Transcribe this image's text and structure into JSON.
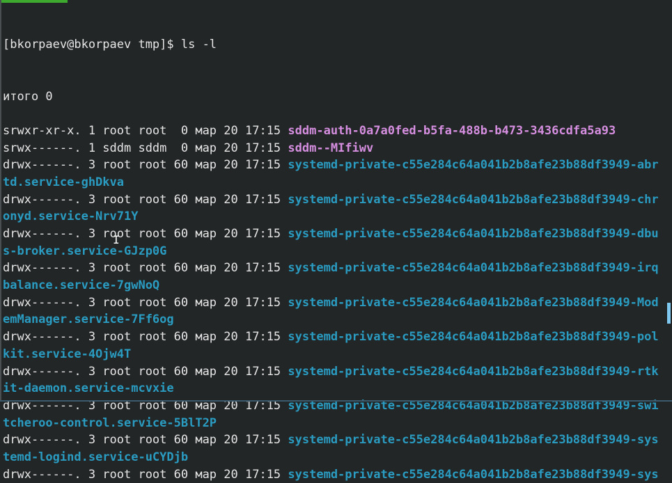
{
  "prompt": "[bkorpaev@bkorpaev tmp]$ ls -l",
  "total": "итого 0",
  "entries": [
    {
      "meta": "srwxr-xr-x. 1 root root  0 мар 20 17:15 ",
      "name": "sddm-auth-0a7a0fed-b5fa-488b-b473-3436cdfa5a93",
      "type": "sock"
    },
    {
      "meta": "srwx------. 1 sddm sddm  0 мар 20 17:15 ",
      "name": "sddm--MIfiwv",
      "type": "sock"
    },
    {
      "meta": "drwx------. 3 root root 60 мар 20 17:15 ",
      "name": "systemd-private-c55e284c64a041b2b8afe23b88df3949-abr",
      "cont": "td.service-ghDkva",
      "type": "dir"
    },
    {
      "meta": "drwx------. 3 root root 60 мар 20 17:15 ",
      "name": "systemd-private-c55e284c64a041b2b8afe23b88df3949-chr",
      "cont": "onyd.service-Nrv71Y",
      "type": "dir"
    },
    {
      "meta": "drwx------. 3 root root 60 мар 20 17:15 ",
      "name": "systemd-private-c55e284c64a041b2b8afe23b88df3949-dbu",
      "cont": "s-broker.service-GJzp0G",
      "type": "dir"
    },
    {
      "meta": "drwx------. 3 root root 60 мар 20 17:15 ",
      "name": "systemd-private-c55e284c64a041b2b8afe23b88df3949-irq",
      "cont": "balance.service-7gwNoQ",
      "type": "dir"
    },
    {
      "meta": "drwx------. 3 root root 60 мар 20 17:15 ",
      "name": "systemd-private-c55e284c64a041b2b8afe23b88df3949-Mod",
      "cont": "emManager.service-7Ff6og",
      "type": "dir"
    },
    {
      "meta": "drwx------. 3 root root 60 мар 20 17:15 ",
      "name": "systemd-private-c55e284c64a041b2b8afe23b88df3949-pol",
      "cont": "kit.service-4Ojw4T",
      "type": "dir"
    },
    {
      "meta": "drwx------. 3 root root 60 мар 20 17:15 ",
      "name": "systemd-private-c55e284c64a041b2b8afe23b88df3949-rtk",
      "cont": "it-daemon.service-mcvxie",
      "type": "dir"
    },
    {
      "meta": "drwx------. 3 root root 60 мар 20 17:15 ",
      "name": "systemd-private-c55e284c64a041b2b8afe23b88df3949-swi",
      "cont": "tcheroo-control.service-5BlT2P",
      "type": "dir"
    },
    {
      "meta": "drwx------. 3 root root 60 мар 20 17:15 ",
      "name": "systemd-private-c55e284c64a041b2b8afe23b88df3949-sys",
      "cont": "temd-logind.service-uCYDjb",
      "type": "dir"
    },
    {
      "meta": "drwx------. 3 root root 60 мар 20 17:15 ",
      "name": "systemd-private-c55e284c64a041b2b8afe23b88df3949-sys",
      "type": "dir"
    }
  ]
}
